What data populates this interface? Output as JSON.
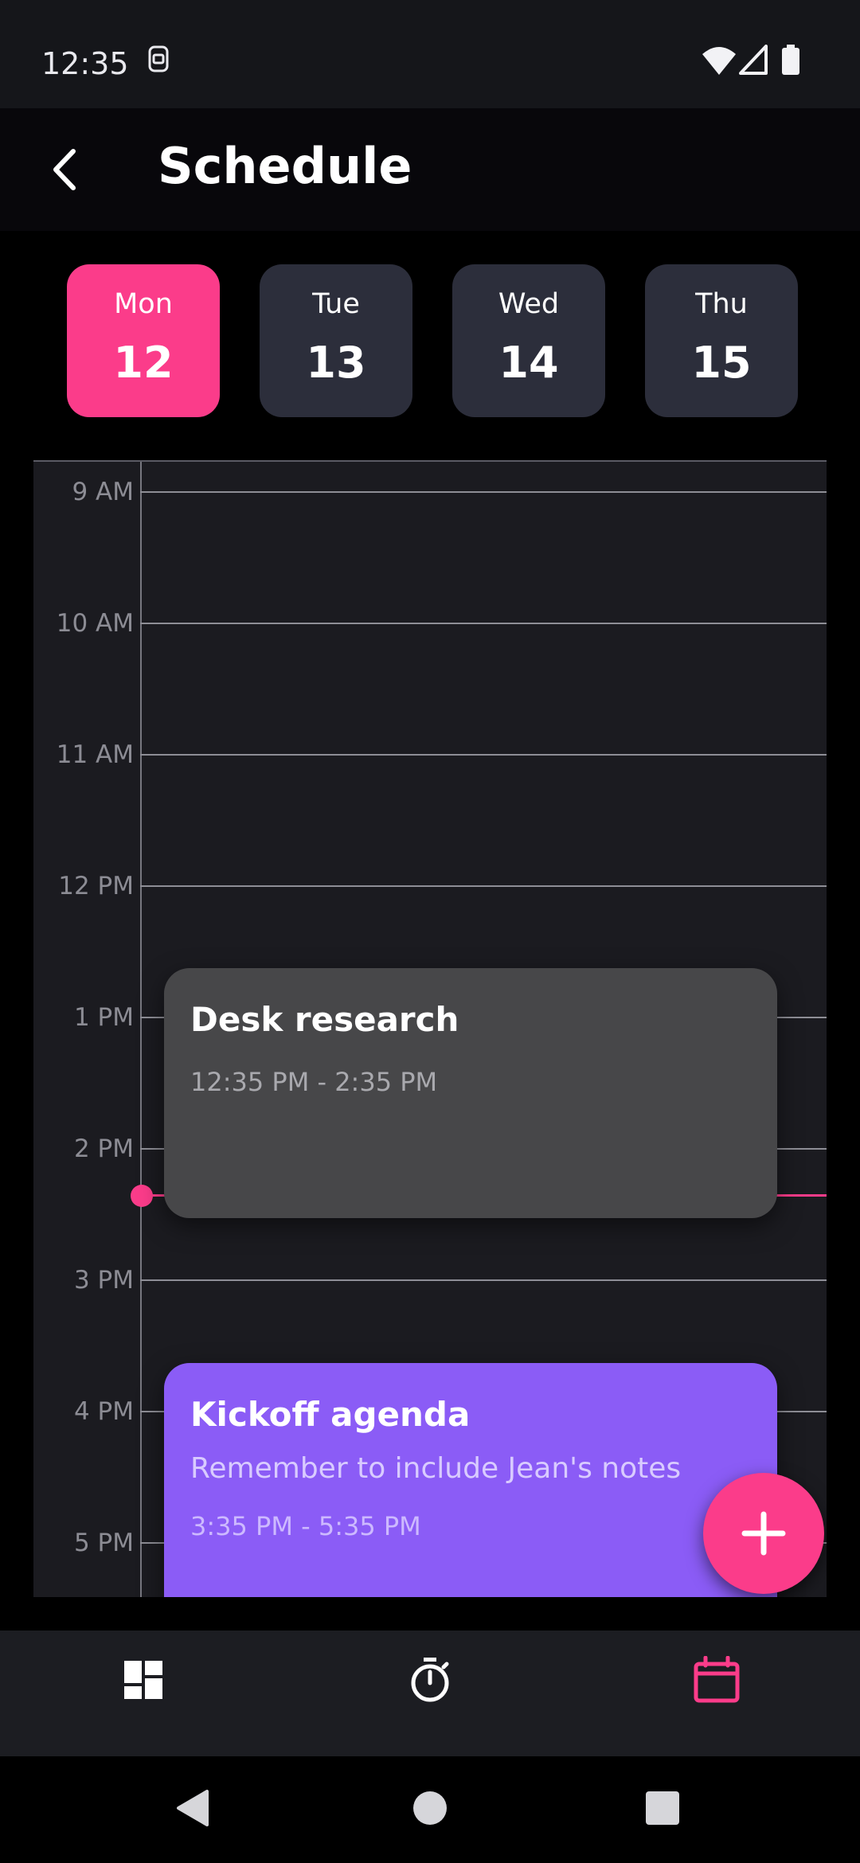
{
  "status_bar": {
    "time": "12:35",
    "icons": [
      "sim-card-icon",
      "wifi-icon",
      "signal-icon",
      "battery-icon"
    ]
  },
  "app_bar": {
    "back_icon": "back-arrow-icon",
    "title": "Schedule"
  },
  "days": [
    {
      "name": "Mon",
      "date": "12",
      "selected": true
    },
    {
      "name": "Tue",
      "date": "13",
      "selected": false
    },
    {
      "name": "Wed",
      "date": "14",
      "selected": false
    },
    {
      "name": "Thu",
      "date": "15",
      "selected": false
    }
  ],
  "timeline": {
    "hours": [
      "9 AM",
      "10 AM",
      "11 AM",
      "12 PM",
      "1 PM",
      "2 PM",
      "3 PM",
      "4 PM",
      "5 PM"
    ],
    "current_time": "12:35 PM"
  },
  "events": [
    {
      "title": "Desk research",
      "note": "",
      "time": "12:35 PM - 2:35 PM",
      "color": "#474749"
    },
    {
      "title": "Kickoff agenda",
      "note": "Remember to include Jean's notes",
      "time": "3:35 PM - 5:35 PM",
      "color": "#8b5cf6"
    }
  ],
  "fab": {
    "icon": "plus-icon"
  },
  "bottom_nav": [
    {
      "icon": "dashboard-icon",
      "active": false
    },
    {
      "icon": "timer-icon",
      "active": false
    },
    {
      "icon": "calendar-icon",
      "active": true
    }
  ],
  "system_nav": [
    "back-triangle-icon",
    "home-circle-icon",
    "recents-square-icon"
  ],
  "colors": {
    "accent": "#fb3c8a",
    "chip": "#2c2e3b",
    "event_gray": "#474749",
    "event_purple": "#8b5cf6"
  }
}
